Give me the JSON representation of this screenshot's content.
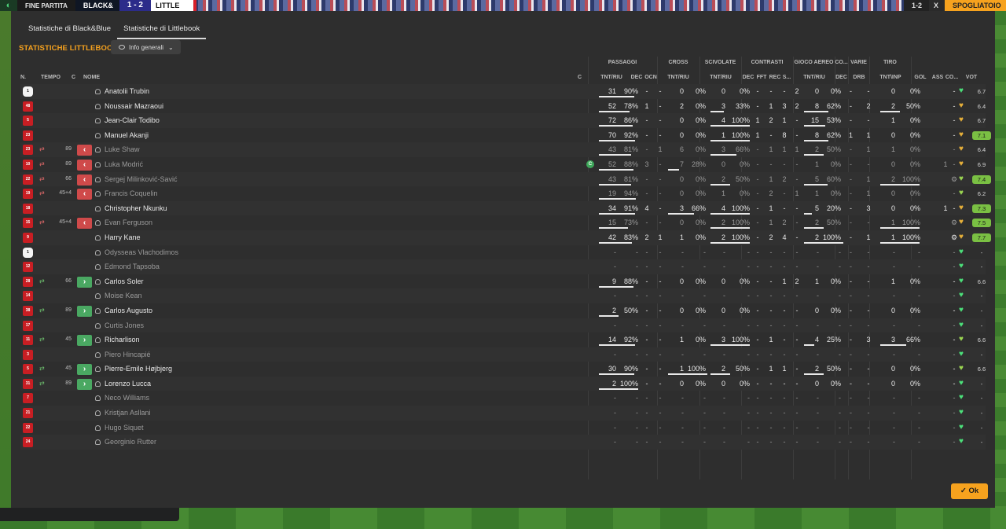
{
  "topbar": {
    "end_label": "FINE PARTITA",
    "home": "BLACK&",
    "score": "1 - 2",
    "away": "LITTLE",
    "time": "1-2",
    "close": "X",
    "action": "SPOGLIATOIO"
  },
  "tabs": [
    {
      "label": "Statistiche di Black&Blue",
      "active": false
    },
    {
      "label": "Statistiche di Littlebook",
      "active": true
    }
  ],
  "section_title": "STATISTICHE LITTLEBOOK",
  "dropdown_label": "Info generali",
  "group_headers": [
    "PASSAGGI",
    "CROSS",
    "SCIVOLATE",
    "CONTRASTI",
    "GIOCO AEREO",
    "CO...",
    "VARIE",
    "TIRO"
  ],
  "column_headers": {
    "n": "N.",
    "tempo": "TEMPO",
    "c": "C",
    "nome": "NOME",
    "c2": "C",
    "p_tnt": "TNT/RIU",
    "p_dec": "DEC",
    "p_ocn": "OCN",
    "cr_tnt": "TNT/RIU",
    "sc_tnt": "TNT/RIU",
    "co_dec": "DEC",
    "co_fft": "FFT",
    "co_rec": "REC",
    "co_s": "S...",
    "ga_tnt": "TNT/RIU",
    "cn_dec": "DEC",
    "va_drb": "DRB",
    "ti_tnt": "TNT\\INP",
    "gol": "GOL",
    "ass": "ASS",
    "co2": "CO...",
    "vot": "VOT"
  },
  "players": [
    {
      "num": "1",
      "gk": true,
      "sub": "",
      "min": "",
      "btn": "",
      "name": "Anatolii Trubin",
      "used": true,
      "cap": false,
      "pt": "31",
      "pp": "90%",
      "pbar": 0.9,
      "pdec": "-",
      "pocn": "-",
      "ct": "0",
      "cp": "0%",
      "cbar": 0,
      "st": "0",
      "sp": "0%",
      "sbar": 0,
      "cd": "-",
      "cf": "-",
      "cr": "-",
      "cs": "2",
      "gt": "0",
      "gp": "0%",
      "gbar": 0,
      "nd": "-",
      "dr": "-",
      "tt": "0",
      "tp": "0%",
      "tbar": 0,
      "gol": "",
      "ass": "-",
      "heart": "green",
      "vot": "6.7",
      "hi": false
    },
    {
      "num": "48",
      "gk": false,
      "sub": "",
      "min": "",
      "btn": "",
      "name": "Noussair Mazraoui",
      "used": true,
      "cap": false,
      "pt": "52",
      "pp": "78%",
      "pbar": 0.78,
      "pdec": "1",
      "pocn": "-",
      "ct": "2",
      "cp": "0%",
      "cbar": 0,
      "st": "3",
      "sp": "33%",
      "sbar": 0.33,
      "cd": "-",
      "cf": "1",
      "cr": "3",
      "cs": "2",
      "gt": "8",
      "gp": "62%",
      "gbar": 0.62,
      "nd": "-",
      "dr": "2",
      "tt": "2",
      "tp": "50%",
      "tbar": 0.5,
      "gol": "",
      "ass": "-",
      "heart": "orange",
      "vot": "6.4",
      "hi": false
    },
    {
      "num": "5",
      "gk": false,
      "sub": "",
      "min": "",
      "btn": "",
      "name": "Jean-Clair Todibo",
      "used": true,
      "cap": false,
      "pt": "72",
      "pp": "86%",
      "pbar": 0.86,
      "pdec": "-",
      "pocn": "-",
      "ct": "0",
      "cp": "0%",
      "cbar": 0,
      "st": "4",
      "sp": "100%",
      "sbar": 1,
      "cd": "1",
      "cf": "2",
      "cr": "1",
      "cs": "-",
      "gt": "15",
      "gp": "53%",
      "gbar": 0.53,
      "nd": "-",
      "dr": "-",
      "tt": "1",
      "tp": "0%",
      "tbar": 0,
      "gol": "",
      "ass": "-",
      "heart": "orange",
      "vot": "6.7",
      "hi": false
    },
    {
      "num": "23",
      "gk": false,
      "sub": "",
      "min": "",
      "btn": "",
      "name": "Manuel Akanji",
      "used": true,
      "cap": false,
      "pt": "70",
      "pp": "92%",
      "pbar": 0.92,
      "pdec": "-",
      "pocn": "-",
      "ct": "0",
      "cp": "0%",
      "cbar": 0,
      "st": "1",
      "sp": "100%",
      "sbar": 1,
      "cd": "1",
      "cf": "-",
      "cr": "8",
      "cs": "-",
      "gt": "8",
      "gp": "62%",
      "gbar": 0.62,
      "nd": "1",
      "dr": "1",
      "tt": "0",
      "tp": "0%",
      "tbar": 0,
      "gol": "",
      "ass": "-",
      "heart": "orange",
      "vot": "7.1",
      "hi": true
    },
    {
      "num": "23",
      "gk": false,
      "sub": "out",
      "min": "89",
      "btn": "out",
      "name": "Luke Shaw",
      "used": false,
      "cap": false,
      "pt": "43",
      "pp": "81%",
      "pbar": 0.81,
      "pdec": "-",
      "pocn": "1",
      "ct": "6",
      "cp": "0%",
      "cbar": 0,
      "st": "3",
      "sp": "66%",
      "sbar": 0.66,
      "cd": "-",
      "cf": "1",
      "cr": "1",
      "cs": "1",
      "gt": "2",
      "gp": "50%",
      "gbar": 0.5,
      "nd": "-",
      "dr": "1",
      "tt": "1",
      "tp": "0%",
      "tbar": 0,
      "gol": "",
      "ass": "-",
      "heart": "orange",
      "vot": "6.4",
      "hi": false
    },
    {
      "num": "10",
      "gk": false,
      "sub": "out",
      "min": "89",
      "btn": "out",
      "name": "Luka Modrić",
      "used": false,
      "cap": true,
      "pt": "52",
      "pp": "88%",
      "pbar": 0.88,
      "pdec": "3",
      "pocn": "-",
      "ct": "7",
      "cp": "28%",
      "cbar": 0.28,
      "st": "0",
      "sp": "0%",
      "sbar": 0,
      "cd": "-",
      "cf": "-",
      "cr": "-",
      "cs": "-",
      "gt": "1",
      "gp": "0%",
      "gbar": 0,
      "nd": "-",
      "dr": "-",
      "tt": "0",
      "tp": "0%",
      "tbar": 0,
      "gol": "1",
      "ass": "-",
      "heart": "orange",
      "vot": "6.9",
      "hi": false
    },
    {
      "num": "22",
      "gk": false,
      "sub": "out",
      "min": "66",
      "btn": "out",
      "name": "Sergej Milinković-Savić",
      "used": false,
      "cap": false,
      "pt": "43",
      "pp": "81%",
      "pbar": 0.81,
      "pdec": "-",
      "pocn": "-",
      "ct": "0",
      "cp": "0%",
      "cbar": 0,
      "st": "2",
      "sp": "50%",
      "sbar": 0.5,
      "cd": "-",
      "cf": "1",
      "cr": "2",
      "cs": "-",
      "gt": "5",
      "gp": "60%",
      "gbar": 0.6,
      "nd": "-",
      "dr": "1",
      "tt": "2",
      "tp": "100%",
      "tbar": 1,
      "gol": "",
      "ass": "⚙",
      "heart": "yg",
      "vot": "7.4",
      "hi": true
    },
    {
      "num": "19",
      "gk": false,
      "sub": "out",
      "min": "45+4",
      "btn": "out",
      "name": "Francis Coquelin",
      "used": false,
      "cap": false,
      "pt": "19",
      "pp": "94%",
      "pbar": 0.94,
      "pdec": "-",
      "pocn": "-",
      "ct": "0",
      "cp": "0%",
      "cbar": 0,
      "st": "1",
      "sp": "0%",
      "sbar": 0,
      "cd": "-",
      "cf": "2",
      "cr": "-",
      "cs": "1",
      "gt": "1",
      "gp": "0%",
      "gbar": 0,
      "nd": "-",
      "dr": "1",
      "tt": "0",
      "tp": "0%",
      "tbar": 0,
      "gol": "",
      "ass": "-",
      "heart": "yg",
      "vot": "6.2",
      "hi": false
    },
    {
      "num": "18",
      "gk": false,
      "sub": "",
      "min": "",
      "btn": "",
      "name": "Christopher Nkunku",
      "used": true,
      "cap": false,
      "pt": "34",
      "pp": "91%",
      "pbar": 0.91,
      "pdec": "4",
      "pocn": "-",
      "ct": "3",
      "cp": "66%",
      "cbar": 0.66,
      "st": "4",
      "sp": "100%",
      "sbar": 1,
      "cd": "-",
      "cf": "1",
      "cr": "-",
      "cs": "-",
      "gt": "5",
      "gp": "20%",
      "gbar": 0.2,
      "nd": "-",
      "dr": "3",
      "tt": "0",
      "tp": "0%",
      "tbar": 0,
      "gol": "1",
      "ass": "-",
      "heart": "orange",
      "vot": "7.3",
      "hi": true
    },
    {
      "num": "15",
      "gk": false,
      "sub": "out",
      "min": "45+4",
      "btn": "out",
      "name": "Evan Ferguson",
      "used": false,
      "cap": false,
      "pt": "15",
      "pp": "73%",
      "pbar": 0.73,
      "pdec": "-",
      "pocn": "-",
      "ct": "0",
      "cp": "0%",
      "cbar": 0,
      "st": "2",
      "sp": "100%",
      "sbar": 1,
      "cd": "-",
      "cf": "1",
      "cr": "2",
      "cs": "-",
      "gt": "2",
      "gp": "50%",
      "gbar": 0.5,
      "nd": "-",
      "dr": "-",
      "tt": "1",
      "tp": "100%",
      "tbar": 1,
      "gol": "",
      "ass": "⚙",
      "heart": "orange",
      "vot": "7.5",
      "hi": true
    },
    {
      "num": "9",
      "gk": false,
      "sub": "",
      "min": "",
      "btn": "",
      "name": "Harry Kane",
      "used": true,
      "cap": false,
      "pt": "42",
      "pp": "83%",
      "pbar": 0.83,
      "pdec": "2",
      "pocn": "1",
      "ct": "1",
      "cp": "0%",
      "cbar": 0,
      "st": "2",
      "sp": "100%",
      "sbar": 1,
      "cd": "-",
      "cf": "2",
      "cr": "4",
      "cs": "-",
      "gt": "2",
      "gp": "100%",
      "gbar": 1,
      "nd": "-",
      "dr": "1",
      "tt": "1",
      "tp": "100%",
      "tbar": 1,
      "gol": "",
      "ass": "⚙",
      "heart": "orange",
      "vot": "7.7",
      "hi": true
    },
    {
      "num": "1",
      "gk": true,
      "sub": "",
      "min": "",
      "btn": "",
      "name": "Odysseas Vlachodimos",
      "used": false,
      "cap": false,
      "pt": "-",
      "pp": "-",
      "pbar": 0,
      "pdec": "-",
      "pocn": "-",
      "ct": "-",
      "cp": "-",
      "cbar": 0,
      "st": "-",
      "sp": "-",
      "sbar": 0,
      "cd": "-",
      "cf": "-",
      "cr": "-",
      "cs": "-",
      "gt": "-",
      "gp": "-",
      "gbar": 0,
      "nd": "-",
      "dr": "-",
      "tt": "-",
      "tp": "-",
      "tbar": 0,
      "gol": "",
      "ass": "-",
      "heart": "green",
      "vot": "-",
      "hi": false
    },
    {
      "num": "12",
      "gk": false,
      "sub": "",
      "min": "",
      "btn": "",
      "name": "Edmond Tapsoba",
      "used": false,
      "cap": false,
      "pt": "-",
      "pp": "-",
      "pbar": 0,
      "pdec": "-",
      "pocn": "-",
      "ct": "-",
      "cp": "-",
      "cbar": 0,
      "st": "-",
      "sp": "-",
      "sbar": 0,
      "cd": "-",
      "cf": "-",
      "cr": "-",
      "cs": "-",
      "gt": "-",
      "gp": "-",
      "gbar": 0,
      "nd": "-",
      "dr": "-",
      "tt": "-",
      "tp": "-",
      "tbar": 0,
      "gol": "",
      "ass": "-",
      "heart": "green",
      "vot": "-",
      "hi": false
    },
    {
      "num": "28",
      "gk": false,
      "sub": "in",
      "min": "66",
      "btn": "in",
      "name": "Carlos Soler",
      "used": true,
      "cap": false,
      "pt": "9",
      "pp": "88%",
      "pbar": 0.88,
      "pdec": "-",
      "pocn": "-",
      "ct": "0",
      "cp": "0%",
      "cbar": 0,
      "st": "0",
      "sp": "0%",
      "sbar": 0,
      "cd": "-",
      "cf": "-",
      "cr": "1",
      "cs": "2",
      "gt": "1",
      "gp": "0%",
      "gbar": 0,
      "nd": "-",
      "dr": "-",
      "tt": "1",
      "tp": "0%",
      "tbar": 0,
      "gol": "",
      "ass": "-",
      "heart": "green",
      "vot": "6.6",
      "hi": false
    },
    {
      "num": "14",
      "gk": false,
      "sub": "",
      "min": "",
      "btn": "",
      "name": "Moise Kean",
      "used": false,
      "cap": false,
      "pt": "-",
      "pp": "-",
      "pbar": 0,
      "pdec": "-",
      "pocn": "-",
      "ct": "-",
      "cp": "-",
      "cbar": 0,
      "st": "-",
      "sp": "-",
      "sbar": 0,
      "cd": "-",
      "cf": "-",
      "cr": "-",
      "cs": "-",
      "gt": "-",
      "gp": "-",
      "gbar": 0,
      "nd": "-",
      "dr": "-",
      "tt": "-",
      "tp": "-",
      "tbar": 0,
      "gol": "",
      "ass": "-",
      "heart": "green",
      "vot": "-",
      "hi": false
    },
    {
      "num": "38",
      "gk": false,
      "sub": "in",
      "min": "89",
      "btn": "in",
      "name": "Carlos Augusto",
      "used": true,
      "cap": false,
      "pt": "2",
      "pp": "50%",
      "pbar": 0.5,
      "pdec": "-",
      "pocn": "-",
      "ct": "0",
      "cp": "0%",
      "cbar": 0,
      "st": "0",
      "sp": "0%",
      "sbar": 0,
      "cd": "-",
      "cf": "-",
      "cr": "-",
      "cs": "-",
      "gt": "0",
      "gp": "0%",
      "gbar": 0,
      "nd": "-",
      "dr": "-",
      "tt": "0",
      "tp": "0%",
      "tbar": 0,
      "gol": "",
      "ass": "-",
      "heart": "green",
      "vot": "-",
      "hi": false
    },
    {
      "num": "17",
      "gk": false,
      "sub": "",
      "min": "",
      "btn": "",
      "name": "Curtis Jones",
      "used": false,
      "cap": false,
      "pt": "-",
      "pp": "-",
      "pbar": 0,
      "pdec": "-",
      "pocn": "-",
      "ct": "-",
      "cp": "-",
      "cbar": 0,
      "st": "-",
      "sp": "-",
      "sbar": 0,
      "cd": "-",
      "cf": "-",
      "cr": "-",
      "cs": "-",
      "gt": "-",
      "gp": "-",
      "gbar": 0,
      "nd": "-",
      "dr": "-",
      "tt": "-",
      "tp": "-",
      "tbar": 0,
      "gol": "",
      "ass": "-",
      "heart": "green",
      "vot": "-",
      "hi": false
    },
    {
      "num": "11",
      "gk": false,
      "sub": "in",
      "min": "45",
      "btn": "in",
      "name": "Richarlison",
      "used": true,
      "cap": false,
      "pt": "14",
      "pp": "92%",
      "pbar": 0.92,
      "pdec": "-",
      "pocn": "-",
      "ct": "1",
      "cp": "0%",
      "cbar": 0,
      "st": "3",
      "sp": "100%",
      "sbar": 1,
      "cd": "-",
      "cf": "1",
      "cr": "-",
      "cs": "-",
      "gt": "4",
      "gp": "25%",
      "gbar": 0.25,
      "nd": "-",
      "dr": "3",
      "tt": "3",
      "tp": "66%",
      "tbar": 0.66,
      "gol": "",
      "ass": "-",
      "heart": "yg",
      "vot": "6.6",
      "hi": false
    },
    {
      "num": "3",
      "gk": false,
      "sub": "",
      "min": "",
      "btn": "",
      "name": "Piero Hincapié",
      "used": false,
      "cap": false,
      "pt": "-",
      "pp": "-",
      "pbar": 0,
      "pdec": "-",
      "pocn": "-",
      "ct": "-",
      "cp": "-",
      "cbar": 0,
      "st": "-",
      "sp": "-",
      "sbar": 0,
      "cd": "-",
      "cf": "-",
      "cr": "-",
      "cs": "-",
      "gt": "-",
      "gp": "-",
      "gbar": 0,
      "nd": "-",
      "dr": "-",
      "tt": "-",
      "tp": "-",
      "tbar": 0,
      "gol": "",
      "ass": "-",
      "heart": "green",
      "vot": "-",
      "hi": false
    },
    {
      "num": "5",
      "gk": false,
      "sub": "in",
      "min": "45",
      "btn": "in",
      "name": "Pierre-Emile Højbjerg",
      "used": true,
      "cap": false,
      "pt": "30",
      "pp": "90%",
      "pbar": 0.9,
      "pdec": "-",
      "pocn": "-",
      "ct": "1",
      "cp": "100%",
      "cbar": 1,
      "st": "2",
      "sp": "50%",
      "sbar": 0.5,
      "cd": "-",
      "cf": "1",
      "cr": "1",
      "cs": "-",
      "gt": "2",
      "gp": "50%",
      "gbar": 0.5,
      "nd": "-",
      "dr": "-",
      "tt": "0",
      "tp": "0%",
      "tbar": 0,
      "gol": "",
      "ass": "-",
      "heart": "yg",
      "vot": "6.6",
      "hi": false
    },
    {
      "num": "31",
      "gk": false,
      "sub": "in",
      "min": "89",
      "btn": "in",
      "name": "Lorenzo Lucca",
      "used": true,
      "cap": false,
      "pt": "2",
      "pp": "100%",
      "pbar": 1,
      "pdec": "-",
      "pocn": "-",
      "ct": "0",
      "cp": "0%",
      "cbar": 0,
      "st": "0",
      "sp": "0%",
      "sbar": 0,
      "cd": "-",
      "cf": "-",
      "cr": "-",
      "cs": "-",
      "gt": "0",
      "gp": "0%",
      "gbar": 0,
      "nd": "-",
      "dr": "-",
      "tt": "0",
      "tp": "0%",
      "tbar": 0,
      "gol": "",
      "ass": "-",
      "heart": "green",
      "vot": "-",
      "hi": false
    },
    {
      "num": "7",
      "gk": false,
      "sub": "",
      "min": "",
      "btn": "",
      "name": "Neco Williams",
      "used": false,
      "cap": false,
      "pt": "-",
      "pp": "-",
      "pbar": 0,
      "pdec": "-",
      "pocn": "-",
      "ct": "-",
      "cp": "-",
      "cbar": 0,
      "st": "-",
      "sp": "-",
      "sbar": 0,
      "cd": "-",
      "cf": "-",
      "cr": "-",
      "cs": "-",
      "gt": "-",
      "gp": "-",
      "gbar": 0,
      "nd": "-",
      "dr": "-",
      "tt": "-",
      "tp": "-",
      "tbar": 0,
      "gol": "",
      "ass": "-",
      "heart": "green",
      "vot": "-",
      "hi": false
    },
    {
      "num": "21",
      "gk": false,
      "sub": "",
      "min": "",
      "btn": "",
      "name": "Kristjan Asllani",
      "used": false,
      "cap": false,
      "pt": "-",
      "pp": "-",
      "pbar": 0,
      "pdec": "-",
      "pocn": "-",
      "ct": "-",
      "cp": "-",
      "cbar": 0,
      "st": "-",
      "sp": "-",
      "sbar": 0,
      "cd": "-",
      "cf": "-",
      "cr": "-",
      "cs": "-",
      "gt": "-",
      "gp": "-",
      "gbar": 0,
      "nd": "-",
      "dr": "-",
      "tt": "-",
      "tp": "-",
      "tbar": 0,
      "gol": "",
      "ass": "-",
      "heart": "green",
      "vot": "-",
      "hi": false
    },
    {
      "num": "22",
      "gk": false,
      "sub": "",
      "min": "",
      "btn": "",
      "name": "Hugo Siquet",
      "used": false,
      "cap": false,
      "pt": "-",
      "pp": "-",
      "pbar": 0,
      "pdec": "-",
      "pocn": "-",
      "ct": "-",
      "cp": "-",
      "cbar": 0,
      "st": "-",
      "sp": "-",
      "sbar": 0,
      "cd": "-",
      "cf": "-",
      "cr": "-",
      "cs": "-",
      "gt": "-",
      "gp": "-",
      "gbar": 0,
      "nd": "-",
      "dr": "-",
      "tt": "-",
      "tp": "-",
      "tbar": 0,
      "gol": "",
      "ass": "-",
      "heart": "green",
      "vot": "-",
      "hi": false
    },
    {
      "num": "24",
      "gk": false,
      "sub": "",
      "min": "",
      "btn": "",
      "name": "Georginio Rutter",
      "used": false,
      "cap": false,
      "pt": "-",
      "pp": "-",
      "pbar": 0,
      "pdec": "-",
      "pocn": "-",
      "ct": "-",
      "cp": "-",
      "cbar": 0,
      "st": "-",
      "sp": "-",
      "sbar": 0,
      "cd": "-",
      "cf": "-",
      "cr": "-",
      "cs": "-",
      "gt": "-",
      "gp": "-",
      "gbar": 0,
      "nd": "-",
      "dr": "-",
      "tt": "-",
      "tp": "-",
      "tbar": 0,
      "gol": "",
      "ass": "-",
      "heart": "green",
      "vot": "-",
      "hi": false
    }
  ],
  "ok_label": "Ok",
  "colors": {
    "accent": "#f6a21e",
    "panel": "#2e2e2e",
    "rating_high": "#7ac043",
    "shirt": "#c81e23",
    "sub_out": "#cf4a4a",
    "sub_in": "#4aa862"
  }
}
